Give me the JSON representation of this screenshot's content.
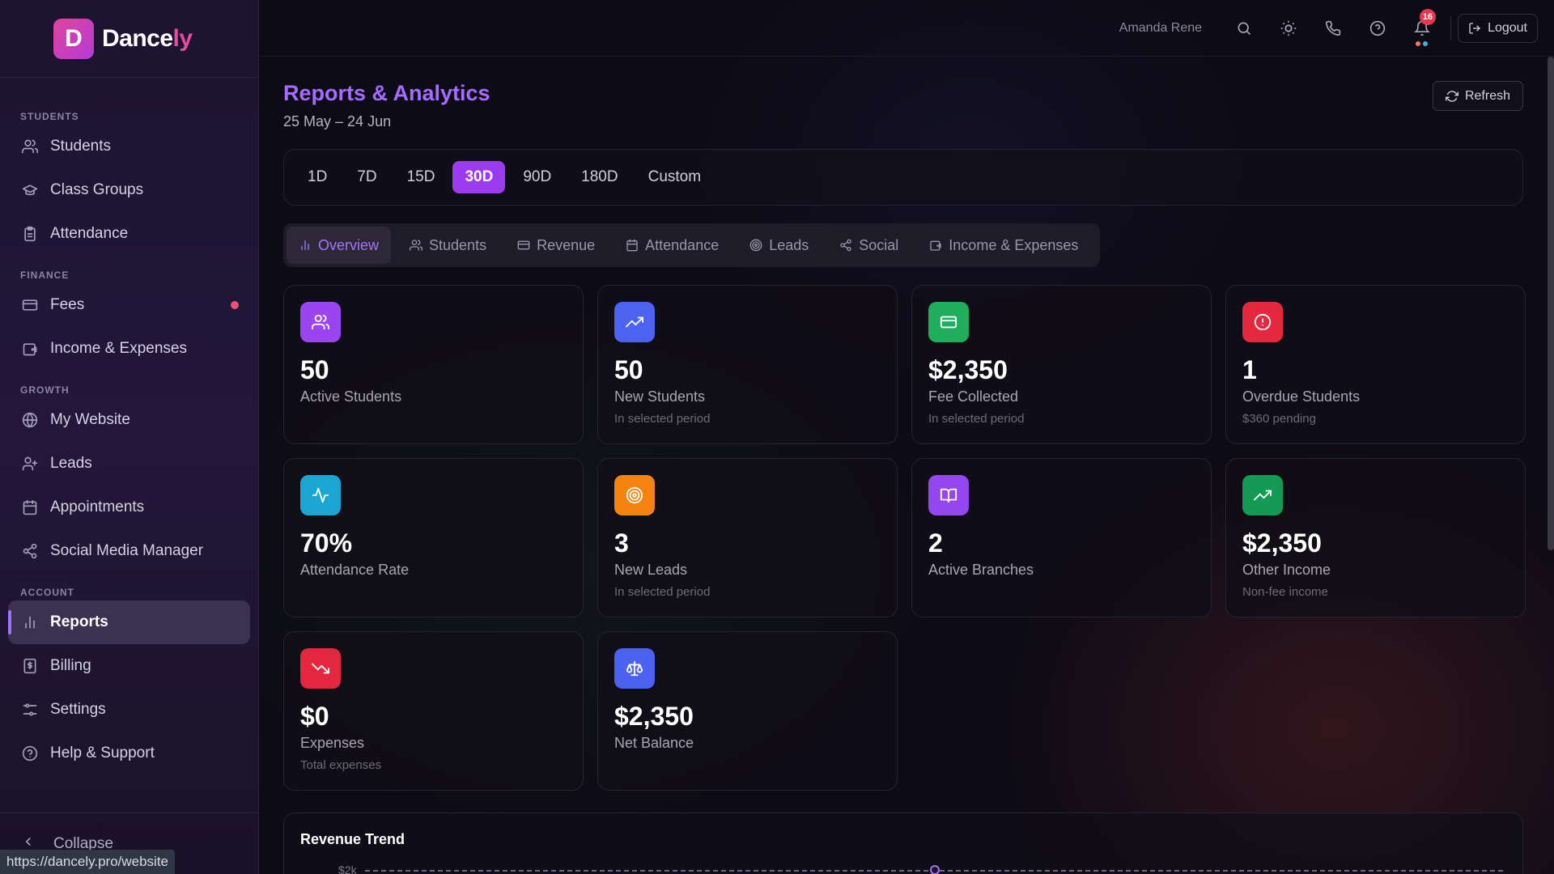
{
  "brand": {
    "logo_letter": "D",
    "name_main": "Dance",
    "name_accent": "ly"
  },
  "sidebar": {
    "sections": [
      {
        "title": "STUDENTS",
        "items": [
          {
            "label": "Students",
            "icon": "users-icon"
          },
          {
            "label": "Class Groups",
            "icon": "graduation-cap-icon"
          },
          {
            "label": "Attendance",
            "icon": "clipboard-icon"
          }
        ]
      },
      {
        "title": "FINANCE",
        "items": [
          {
            "label": "Fees",
            "icon": "credit-card-icon",
            "dot": true
          },
          {
            "label": "Income & Expenses",
            "icon": "wallet-icon"
          }
        ]
      },
      {
        "title": "GROWTH",
        "items": [
          {
            "label": "My Website",
            "icon": "globe-icon"
          },
          {
            "label": "Leads",
            "icon": "user-plus-icon"
          },
          {
            "label": "Appointments",
            "icon": "calendar-icon"
          },
          {
            "label": "Social Media Manager",
            "icon": "share-icon"
          }
        ]
      },
      {
        "title": "ACCOUNT",
        "items": [
          {
            "label": "Reports",
            "icon": "bar-chart-icon",
            "active": true
          },
          {
            "label": "Billing",
            "icon": "receipt-icon"
          },
          {
            "label": "Settings",
            "icon": "sliders-icon"
          },
          {
            "label": "Help & Support",
            "icon": "help-circle-icon"
          }
        ]
      }
    ],
    "collapse_label": "Collapse"
  },
  "statusbar": {
    "url": "https://dancely.pro/website"
  },
  "topbar": {
    "user_name": "Amanda Rene",
    "notification_count": "16",
    "logout_label": "Logout",
    "icons": [
      "search-icon",
      "sun-icon",
      "phone-icon",
      "help-icon",
      "bell-icon"
    ]
  },
  "header": {
    "title": "Reports & Analytics",
    "date_range": "25 May – 24 Jun",
    "refresh_label": "Refresh"
  },
  "periods": {
    "options": [
      "1D",
      "7D",
      "15D",
      "30D",
      "90D",
      "180D",
      "Custom"
    ],
    "selected": "30D"
  },
  "tabs": {
    "items": [
      {
        "label": "Overview",
        "icon": "bar-chart-icon"
      },
      {
        "label": "Students",
        "icon": "users-icon"
      },
      {
        "label": "Revenue",
        "icon": "credit-card-icon"
      },
      {
        "label": "Attendance",
        "icon": "calendar-icon"
      },
      {
        "label": "Leads",
        "icon": "target-icon"
      },
      {
        "label": "Social",
        "icon": "share-icon"
      },
      {
        "label": "Income & Expenses",
        "icon": "wallet-icon"
      }
    ],
    "selected": "Overview"
  },
  "stats": [
    {
      "value": "50",
      "label": "Active Students",
      "sub": "",
      "icon": "users-icon",
      "color": "#9b45f0"
    },
    {
      "value": "50",
      "label": "New Students",
      "sub": "In selected period",
      "icon": "trending-up-icon",
      "color": "#4b63f0"
    },
    {
      "value": "$2,350",
      "label": "Fee Collected",
      "sub": "In selected period",
      "icon": "credit-card-icon",
      "color": "#1fae5b"
    },
    {
      "value": "1",
      "label": "Overdue Students",
      "sub": "$360 pending",
      "icon": "alert-circle-icon",
      "color": "#e6283f"
    },
    {
      "value": "70%",
      "label": "Attendance Rate",
      "sub": "",
      "icon": "activity-icon",
      "color": "#1ba6d4"
    },
    {
      "value": "3",
      "label": "New Leads",
      "sub": "In selected period",
      "icon": "target-icon",
      "color": "#f5830f"
    },
    {
      "value": "2",
      "label": "Active Branches",
      "sub": "",
      "icon": "book-open-icon",
      "color": "#9447ef"
    },
    {
      "value": "$2,350",
      "label": "Other Income",
      "sub": "Non-fee income",
      "icon": "trending-up-icon",
      "color": "#139a55"
    },
    {
      "value": "$0",
      "label": "Expenses",
      "sub": "Total expenses",
      "icon": "trending-down-icon",
      "color": "#e5263f"
    },
    {
      "value": "$2,350",
      "label": "Net Balance",
      "sub": "",
      "icon": "scale-icon",
      "color": "#4a62ef"
    }
  ],
  "revenue_trend": {
    "title": "Revenue Trend",
    "y_tick": "$2k"
  }
}
